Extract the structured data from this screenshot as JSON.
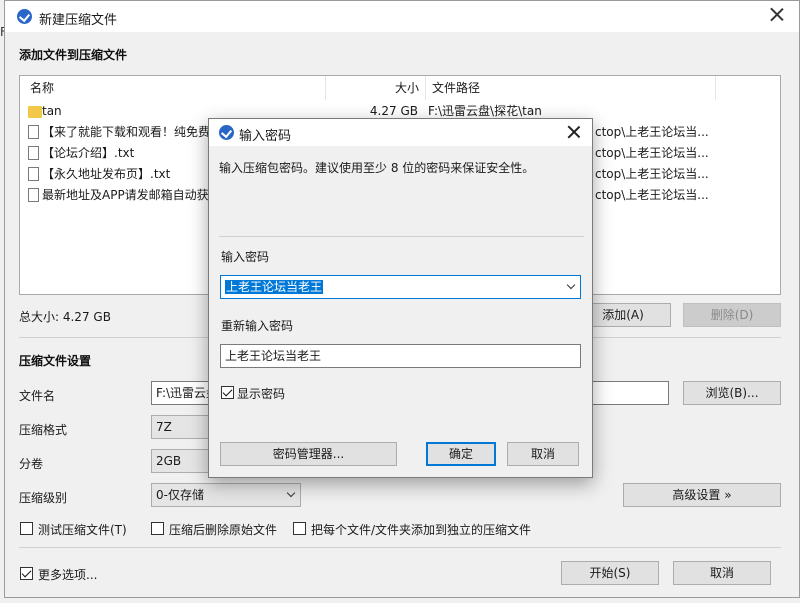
{
  "window": {
    "title": "新建压缩文件",
    "bg_letter": "F"
  },
  "files_section": {
    "title": "添加文件到压缩文件",
    "columns": [
      "名称",
      "大小",
      "文件路径"
    ],
    "rows": [
      {
        "icon": "folder-icon",
        "name": "tan",
        "size": "4.27 GB",
        "path": "F:\\迅雷云盘\\探花\\tan"
      },
      {
        "icon": "document-icon",
        "name": "【来了就能下载和观看！纯免费",
        "size": "",
        "path": "ctop\\上老王论坛当..."
      },
      {
        "icon": "document-icon",
        "name": "【论坛介绍】.txt",
        "size": "",
        "path": "ctop\\上老王论坛当..."
      },
      {
        "icon": "document-icon",
        "name": "【永久地址发布页】.txt",
        "size": "",
        "path": "ctop\\上老王论坛当..."
      },
      {
        "icon": "document-icon",
        "name": "最新地址及APP请发邮箱自动获",
        "size": "",
        "path": "ctop\\上老王论坛当..."
      }
    ],
    "total_size": "总大小: 4.27 GB",
    "add_label": "添加(A)",
    "delete_label": "删除(D)"
  },
  "settings": {
    "title": "压缩文件设置",
    "filename_label": "文件名",
    "filename_value": "F:\\迅雷云盘",
    "browse_label": "浏览(B)...",
    "format_label": "压缩格式",
    "format_value": "7Z",
    "volume_label": "分卷",
    "volume_value": "2GB",
    "level_label": "压缩级别",
    "level_value": "0-仅存储",
    "advanced_label": "高级设置 »",
    "test_label": "测试压缩文件(T)",
    "delete_source_label": "压缩后删除原始文件",
    "separate_label": "把每个文件/文件夹添加到独立的压缩文件",
    "more_options_label": "更多选项...",
    "start_label": "开始(S)",
    "cancel_label": "取消"
  },
  "dialog": {
    "title": "输入密码",
    "description": "输入压缩包密码。建议使用至少 8 位的密码来保证安全性。",
    "password_label": "输入密码",
    "password_value": "上老王论坛当老王",
    "reenter_label": "重新输入密码",
    "reenter_value": "上老王论坛当老王",
    "show_password_label": "显示密码",
    "show_password_checked": true,
    "manager_label": "密码管理器...",
    "ok_label": "确定",
    "cancel_label": "取消"
  },
  "colors": {
    "accent": "#0078d7",
    "app_icon": "#2a66c8",
    "folder": "#f2c84b"
  }
}
